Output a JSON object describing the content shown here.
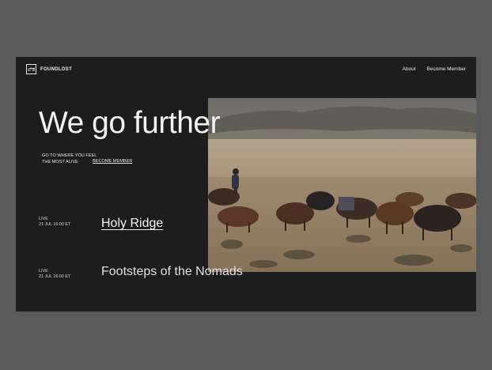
{
  "brand": {
    "name": "FOUNDLOST",
    "icon": "camel-icon"
  },
  "nav": {
    "items": [
      "About",
      "Become Member"
    ]
  },
  "hero": {
    "headline": "We go further",
    "tagline_line1": "GO TO WHERE YOU FEEL",
    "tagline_line2": "THE MOST ALIVE",
    "cta": "BECOME MEMBER",
    "photo": "herder-on-horseback-with-yaks"
  },
  "events": [
    {
      "status": "LIVE",
      "datetime": "21 JUL 16:00 ET",
      "title": "Holy Ridge"
    },
    {
      "status": "LIVE",
      "datetime": "21 JUL 16:00 ET",
      "title": "Footsteps of the Nomads"
    }
  ],
  "colors": {
    "page_bg": "#5a5a5a",
    "panel_bg": "#1d1d1d",
    "text": "#f2f2f2"
  }
}
